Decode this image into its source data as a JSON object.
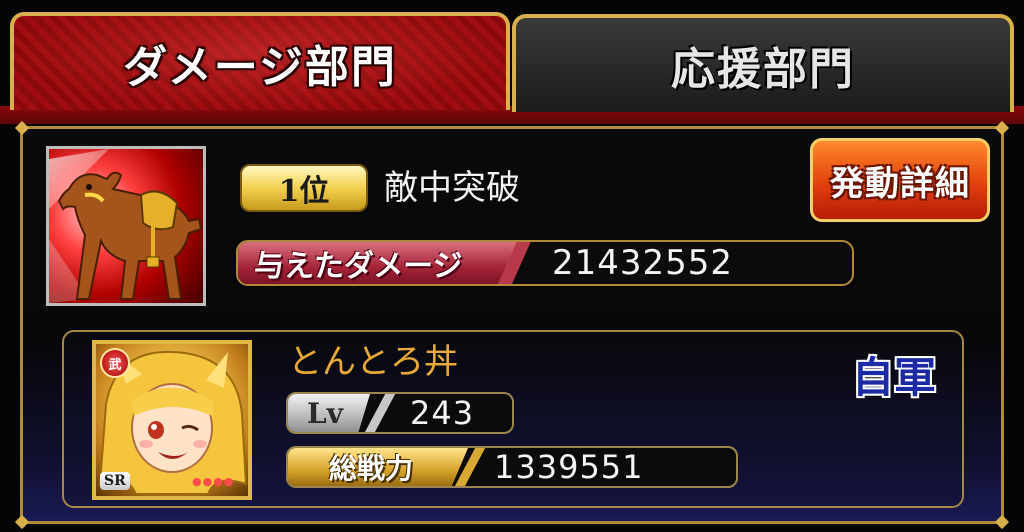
{
  "tabs": [
    {
      "label": "ダメージ部門",
      "active": true
    },
    {
      "label": "応援部門",
      "active": false
    }
  ],
  "skill": {
    "rank": "1位",
    "name": "敵中突破",
    "icon": "horse-icon",
    "detail_button_label": "発動詳細",
    "damage_label": "与えたダメージ",
    "damage_value": "21432552"
  },
  "player": {
    "name": "とんとろ丼",
    "army": "自軍",
    "avatar": "card-portrait",
    "type_badge": "武",
    "rarity": "SR",
    "stars": "●●●●",
    "lv_label": "Lv",
    "lv_value": "243",
    "power_label": "総戦力",
    "power_value": "1339551"
  },
  "colors": {
    "tab_active": "#a00d10",
    "tab_inactive": "#2a2a2a",
    "gold_border": "#d8b04c",
    "player_name": "#e7a93a",
    "army_label": "#1c2aa6"
  }
}
